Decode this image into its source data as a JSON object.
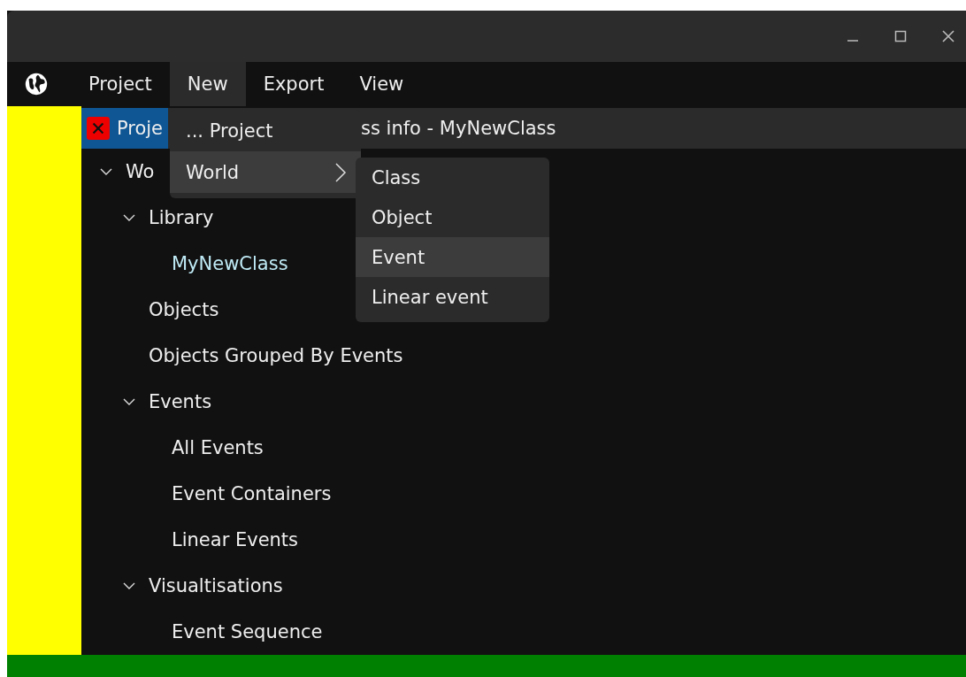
{
  "menu_bar": {
    "items": [
      {
        "label": "Project",
        "selected": false
      },
      {
        "label": "New",
        "selected": true
      },
      {
        "label": "Export",
        "selected": false
      },
      {
        "label": "View",
        "selected": false
      }
    ]
  },
  "tabs": [
    {
      "label": "Proje",
      "selected": true,
      "closable": true
    },
    {
      "label": "ss info - MyNewClass",
      "selected": false,
      "closable": false
    }
  ],
  "tree": [
    {
      "label": "Wo",
      "expanded": true,
      "selected": false,
      "children": [
        {
          "label": "Library",
          "expanded": true,
          "selected": false,
          "children": [
            {
              "label": "MyNewClass",
              "selected": true
            }
          ]
        },
        {
          "label": "Objects",
          "selected": false
        },
        {
          "label": "Objects Grouped By Events",
          "selected": false
        },
        {
          "label": "Events",
          "expanded": true,
          "selected": false,
          "children": [
            {
              "label": "All Events",
              "selected": false
            },
            {
              "label": "Event Containers",
              "selected": false
            },
            {
              "label": "Linear Events",
              "selected": false
            }
          ]
        },
        {
          "label": "Visualtisations",
          "expanded": true,
          "selected": false,
          "children": [
            {
              "label": "Event Sequence",
              "selected": false
            }
          ]
        }
      ]
    }
  ],
  "dropdown": {
    "items": [
      {
        "label": "... Project",
        "selected": false,
        "has_submenu": false
      },
      {
        "label": "World",
        "selected": true,
        "has_submenu": true
      }
    ]
  },
  "submenu": {
    "items": [
      {
        "label": "Class",
        "selected": false
      },
      {
        "label": "Object",
        "selected": false
      },
      {
        "label": "Event",
        "selected": true
      },
      {
        "label": "Linear event",
        "selected": false
      }
    ]
  }
}
